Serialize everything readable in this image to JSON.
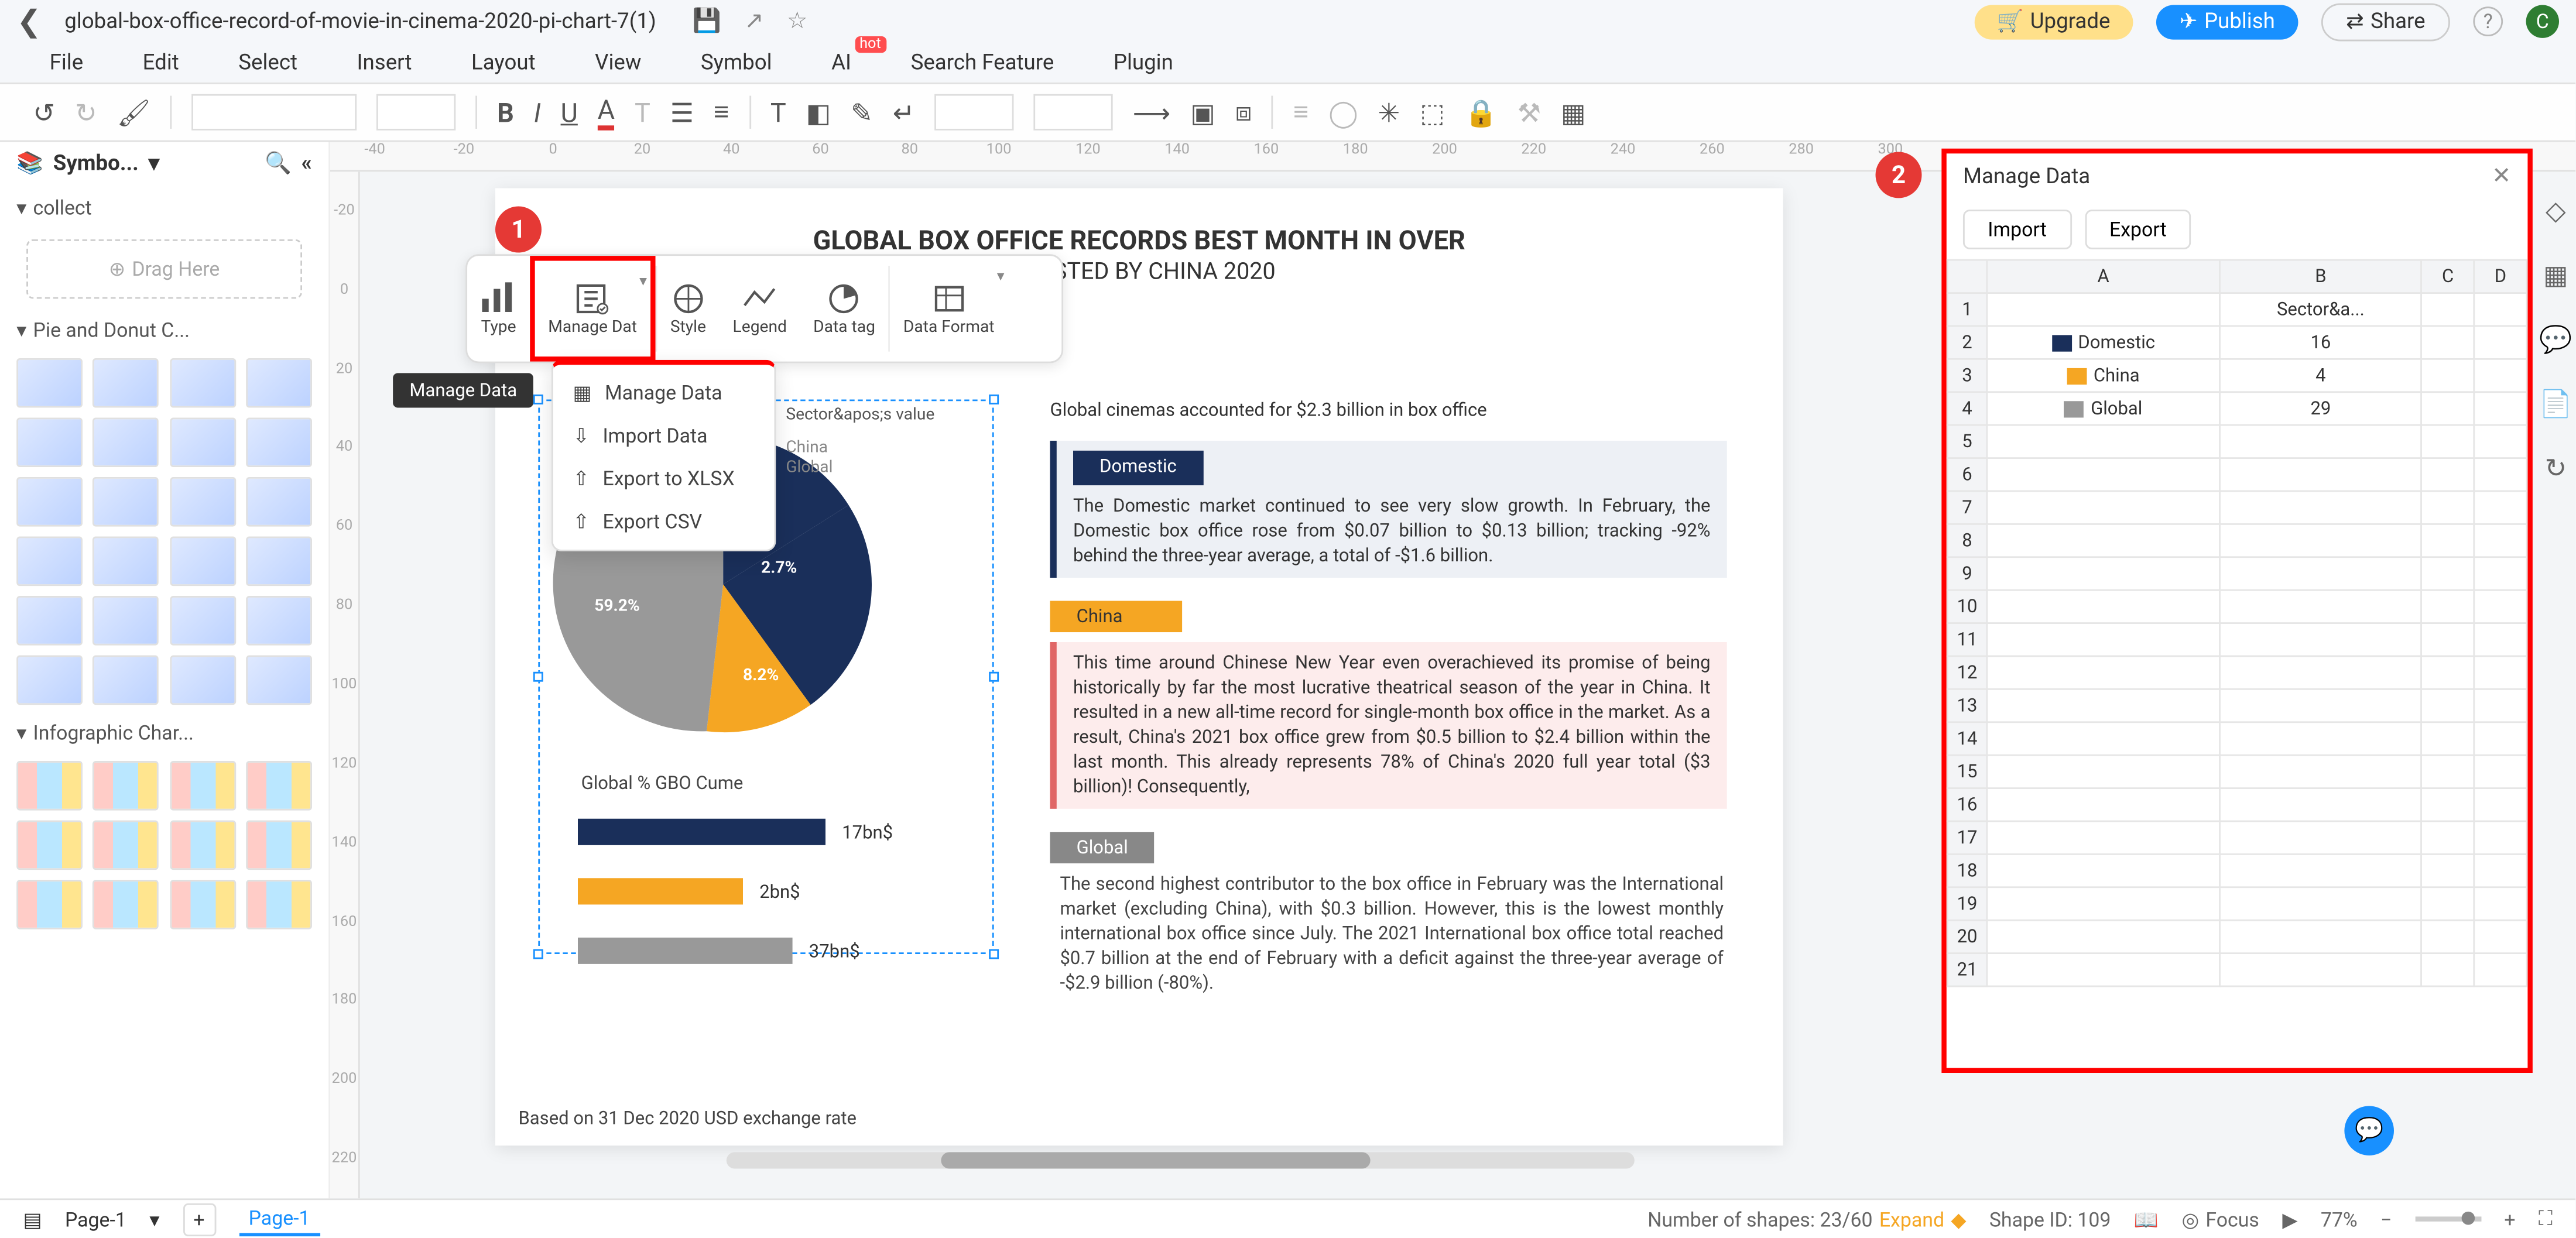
{
  "titlebar": {
    "doc_name": "global-box-office-record-of-movie-in-cinema-2020-pi-chart-7(1)",
    "upgrade_label": "Upgrade",
    "publish_label": "Publish",
    "share_label": "Share",
    "avatar_initial": "C"
  },
  "menubar": {
    "file": "File",
    "edit": "Edit",
    "select": "Select",
    "insert": "Insert",
    "layout": "Layout",
    "view": "View",
    "symbol": "Symbol",
    "ai": "AI",
    "ai_hot": "hot",
    "search": "Search Feature",
    "plugin": "Plugin"
  },
  "leftpanel": {
    "header": "Symbo...",
    "collect": "collect",
    "drag": "Drag Here",
    "pie_section": "Pie and Donut C...",
    "info_section": "Infographic Char..."
  },
  "ruler_h": [
    "-40",
    "-20",
    "0",
    "20",
    "40",
    "60",
    "80",
    "100",
    "120",
    "140",
    "160",
    "180",
    "200",
    "220",
    "240",
    "260",
    "280",
    "300"
  ],
  "ruler_v": [
    "-20",
    "0",
    "20",
    "40",
    "60",
    "80",
    "100",
    "120",
    "140",
    "160",
    "180",
    "200",
    "220"
  ],
  "ribbon": {
    "type": "Type",
    "manage": "Manage Dat",
    "style": "Style",
    "legend": "Legend",
    "datatag": "Data tag",
    "dataformat": "Data Format"
  },
  "dropdown": {
    "manage": "Manage Data",
    "import": "Import Data",
    "export_xlsx": "Export to XLSX",
    "export_csv": "Export CSV"
  },
  "tooltip": "Manage Data",
  "page": {
    "title_l1": "GLOBAL BOX OFFICE RECORDS BEST MONTH IN OVER",
    "title_l2": "OSTED BY CHINA 2020",
    "lead": "Global cinemas accounted for $2.3 billion in box office",
    "note": "Based on 31 Dec 2020 USD exchange rate",
    "pie_caption": "Global % GBO Cume",
    "legend_hdr": "Sector&apos;s value",
    "legend_china": "China",
    "legend_global": "Global",
    "grey_pct": "59.2%",
    "yel_pct": "8.2%",
    "blue_pct": "2.7%",
    "bar_navy": "17bn$",
    "bar_yellow": "2bn$",
    "bar_grey": "37bn$",
    "chips": {
      "domestic": "Domestic",
      "china": "China",
      "global": "Global"
    },
    "p1": "The Domestic market continued to see very slow growth. In February, the Domestic box office rose from $0.07 billion to $0.13 billion; tracking -92% behind the three-year average, a total of -$1.6 billion.",
    "p2": "This time around Chinese New Year even overachieved its promise of being historically by far the most lucrative theatrical season of the year in China. It resulted in a new all-time record for single-month box office in the market. As a result, China's 2021 box office grew from $0.5 billion to $2.4 billion within the last month. This already represents 78% of China's 2020 full year total ($3 billion)! Consequently,",
    "p3": "The second highest contributor to the box office in February was the International market (excluding China), with $0.3 billion. However, this is the lowest monthly international box office since July. The 2021 International box office total reached $0.7 billion at the end of February with a deficit against the three-year average of -$2.9 billion (-80%)."
  },
  "chart_data": {
    "type": "pie",
    "title": "Global % GBO Cume",
    "categories": [
      "Domestic",
      "China",
      "Global"
    ],
    "values": [
      16,
      4,
      29
    ],
    "percent_labels": [
      "2.7%",
      "8.2%",
      "59.2%"
    ],
    "colors": [
      "#1a2f5a",
      "#f5a623",
      "#999999"
    ],
    "bar_values": {
      "Domestic": "17bn$",
      "China": "2bn$",
      "Global": "37bn$"
    }
  },
  "manage_panel": {
    "title": "Manage Data",
    "import": "Import",
    "export": "Export",
    "cols": [
      "",
      "A",
      "B",
      "C",
      "D"
    ],
    "rows": [
      {
        "n": "1",
        "a": "",
        "b": "Sector&a...",
        "c": "",
        "d": ""
      },
      {
        "n": "2",
        "a": "Domestic",
        "b": "16",
        "sw": "navy"
      },
      {
        "n": "3",
        "a": "China",
        "b": "4",
        "sw": "yel"
      },
      {
        "n": "4",
        "a": "Global",
        "b": "29",
        "sw": "gr"
      },
      {
        "n": "5"
      },
      {
        "n": "6"
      },
      {
        "n": "7"
      },
      {
        "n": "8"
      },
      {
        "n": "9"
      },
      {
        "n": "10"
      },
      {
        "n": "11"
      },
      {
        "n": "12"
      },
      {
        "n": "13"
      },
      {
        "n": "14"
      },
      {
        "n": "15"
      },
      {
        "n": "16"
      },
      {
        "n": "17"
      },
      {
        "n": "18"
      },
      {
        "n": "19"
      },
      {
        "n": "20"
      },
      {
        "n": "21"
      }
    ]
  },
  "footer": {
    "page_combo": "Page-1",
    "page_tab": "Page-1",
    "shapes": "Number of shapes: 23/60",
    "expand": "Expand",
    "shape_id": "Shape ID: 109",
    "focus": "Focus",
    "zoom": "77%"
  },
  "markers": {
    "m1": "1",
    "m2": "2"
  }
}
